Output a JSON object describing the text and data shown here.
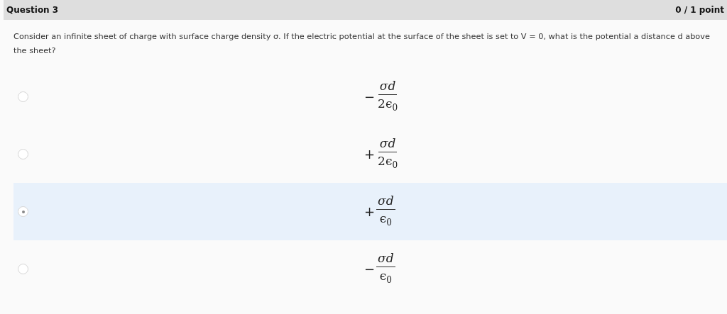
{
  "question": {
    "title": "Question 3",
    "score": "0 / 1 point",
    "text": "Consider an infinite sheet of charge with surface charge density σ. If the electric potential at the surface of the sheet is set to V = 0, what is the potential a distance d above the sheet?"
  },
  "options": [
    {
      "selected": false,
      "sign": "−",
      "numerator": "σd",
      "denominator": "2ϵ$_{0}$"
    },
    {
      "selected": false,
      "sign": "+",
      "numerator": "σd",
      "denominator": "2ϵ$_{0}$"
    },
    {
      "selected": true,
      "sign": "+",
      "numerator": "σd",
      "denominator": "ϵ$_{0}$"
    },
    {
      "selected": false,
      "sign": "−",
      "numerator": "σd",
      "denominator": "ϵ$_{0}$"
    }
  ]
}
